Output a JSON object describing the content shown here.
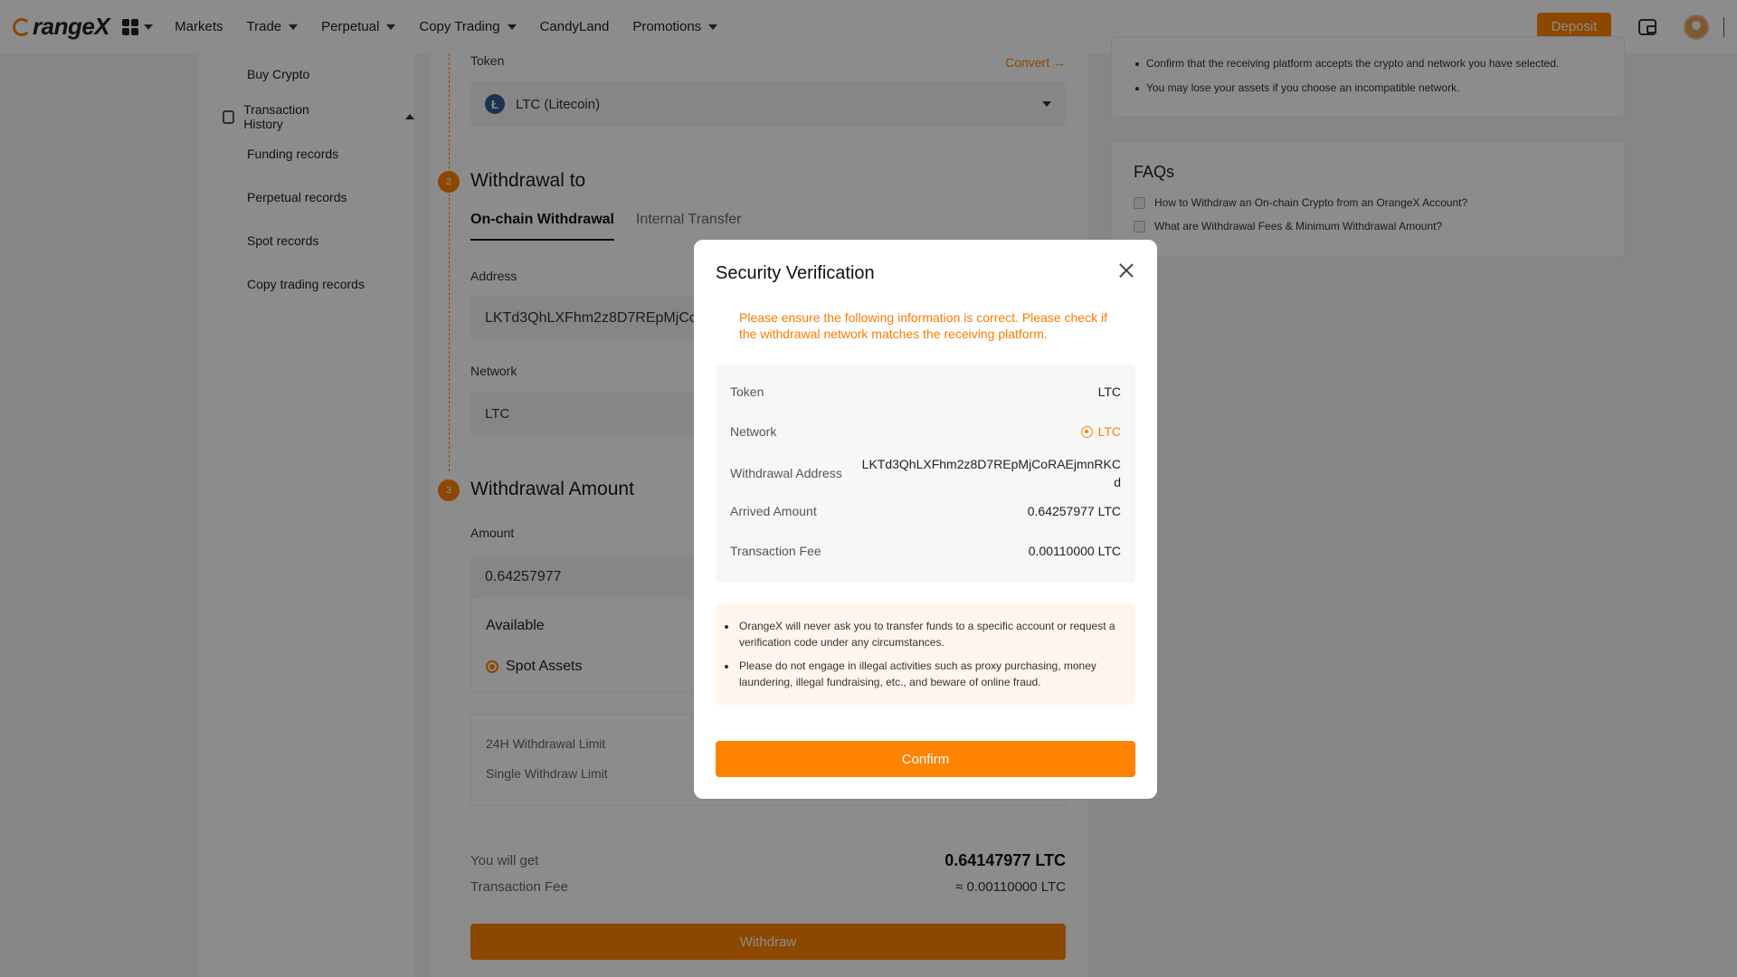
{
  "nav": {
    "logo_text": "rangeX",
    "items": [
      {
        "label": "Markets",
        "dropdown": false
      },
      {
        "label": "Trade",
        "dropdown": true
      },
      {
        "label": "Perpetual",
        "dropdown": true
      },
      {
        "label": "Copy Trading",
        "dropdown": true
      },
      {
        "label": "CandyLand",
        "dropdown": false
      },
      {
        "label": "Promotions",
        "dropdown": true
      }
    ],
    "deposit_label": "Deposit"
  },
  "sidebar": {
    "buy_crypto": "Buy Crypto",
    "transaction_history": "Transaction History",
    "items": [
      "Funding records",
      "Perpetual records",
      "Spot records",
      "Copy trading records"
    ]
  },
  "main": {
    "token_label": "Token",
    "convert_label": "Convert →",
    "token_value": "LTC (Litecoin)",
    "step2_num": "2",
    "step2_title": "Withdrawal to",
    "tab_onchain": "On-chain Withdrawal",
    "tab_internal": "Internal Transfer",
    "address_label": "Address",
    "address_value": "LKTd3QhLXFhm2z8D7REpMjCo",
    "network_label": "Network",
    "network_value": "LTC",
    "step3_num": "3",
    "step3_title": "Withdrawal Amount",
    "amount_label": "Amount",
    "amount_value": "0.64257977",
    "available_title": "Available",
    "spot_assets": "Spot Assets",
    "limit_24h": "24H Withdrawal Limit",
    "limit_single": "Single Withdraw Limit",
    "you_will_get_label": "You will get",
    "you_will_get_value": "0.64147977 LTC",
    "fee_label": "Transaction Fee",
    "fee_value": "≈ 0.00110000 LTC",
    "withdraw_label": "Withdraw"
  },
  "right": {
    "tips": [
      "Confirm that the receiving platform accepts the crypto and network you have selected.",
      "You may lose your assets if you choose an incompatible network."
    ],
    "faq_title": "FAQs",
    "faqs": [
      "How to Withdraw an On-chain Crypto from an OrangeX Account?",
      "What are Withdrawal Fees & Minimum Withdrawal Amount?"
    ]
  },
  "modal": {
    "title": "Security Verification",
    "warning": "Please ensure the following information is correct. Please check if the withdrawal network matches the receiving platform.",
    "rows": [
      {
        "label": "Token",
        "value": "LTC"
      },
      {
        "label": "Network",
        "value": "LTC"
      },
      {
        "label": "Withdrawal Address",
        "value": "LKTd3QhLXFhm2z8D7REpMjCoRAEjmnRKCd"
      },
      {
        "label": "Arrived Amount",
        "value": "0.64257977 LTC"
      },
      {
        "label": "Transaction Fee",
        "value": "0.00110000 LTC"
      }
    ],
    "notices": [
      "OrangeX will never ask you to transfer funds to a specific account or request a verification code under any circumstances.",
      "Please do not engage in illegal activities such as proxy purchasing, money laundering, illegal fundraising, etc., and beware of online fraud."
    ],
    "confirm_label": "Confirm"
  },
  "colors": {
    "accent": "#ff8200",
    "overlay": "rgba(0,0,0,0.45)"
  }
}
